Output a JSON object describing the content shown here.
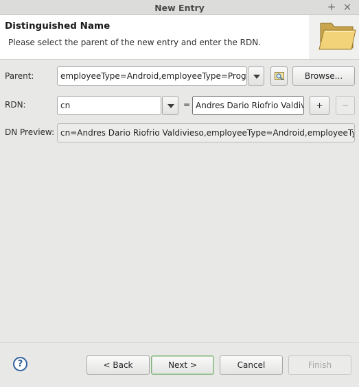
{
  "window": {
    "title": "New Entry",
    "add_label": "+",
    "close_label": "×"
  },
  "header": {
    "title": "Distinguished Name",
    "description": "Please select the parent of the new entry and enter the RDN.",
    "icon": "folder-icon"
  },
  "form": {
    "parent_label": "Parent:",
    "parent_value": "employeeType=Android,employeeType=Programador,ou=Personal,dc=example,dc=com",
    "browse_label": "Browse...",
    "rdn_label": "RDN:",
    "rdn_attribute": "cn",
    "rdn_equals": "=",
    "rdn_value": "Andres Dario Riofrio Valdivieso",
    "add_rdn_label": "+",
    "remove_rdn_label": "−",
    "dn_preview_label": "DN Preview:",
    "dn_preview_value": "cn=Andres Dario Riofrio Valdivieso,employeeType=Android,employeeType=Programador,ou=Personal,dc=example,dc=com"
  },
  "footer": {
    "help_label": "?",
    "back_label": "< Back",
    "next_label": "Next >",
    "cancel_label": "Cancel",
    "finish_label": "Finish"
  }
}
